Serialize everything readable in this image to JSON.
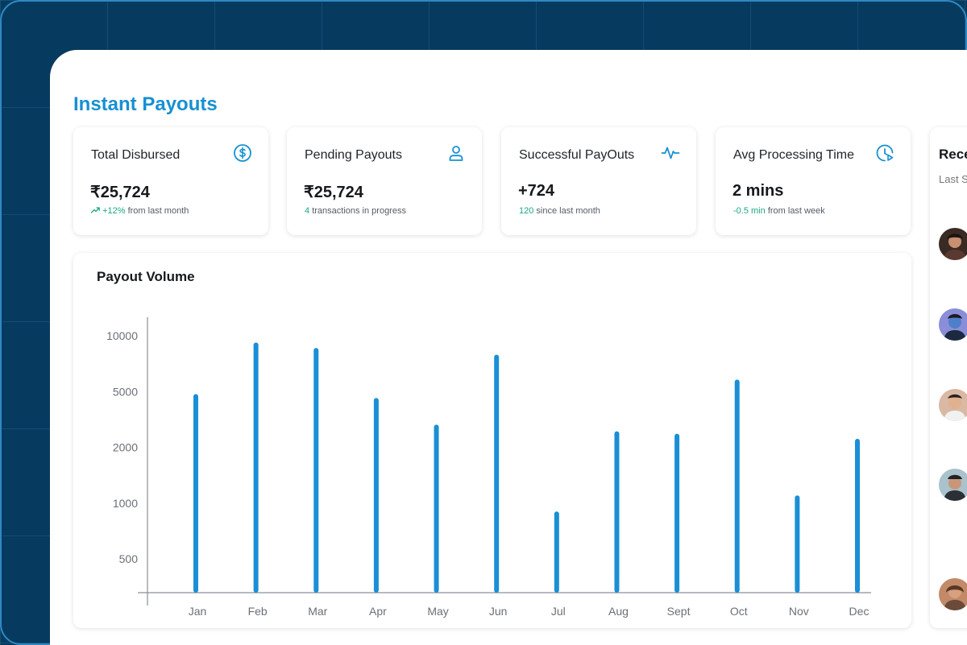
{
  "page": {
    "title": "Instant Payouts"
  },
  "cards": [
    {
      "title": "Total Disbursed",
      "icon": "dollar-circle-icon",
      "value": "₹25,724",
      "sub_accent": "+12%",
      "sub_text": "from last month",
      "trend_icon": "trend-up-icon"
    },
    {
      "title": "Pending Payouts",
      "icon": "user-icon",
      "value": "₹25,724",
      "sub_accent": "4",
      "sub_text": "transactions in progress"
    },
    {
      "title": "Successful PayOuts",
      "icon": "activity-icon",
      "value": "+724",
      "sub_accent": "120",
      "sub_text": "since last month"
    },
    {
      "title": "Avg Processing Time",
      "icon": "clock-play-icon",
      "value": "2 mins",
      "sub_accent": "-0.5 min",
      "sub_text": "from last week"
    }
  ],
  "side_panel": {
    "title": "Rece",
    "subtitle": "Last S"
  },
  "colors": {
    "accent": "#1790d2",
    "bar": "#1a8fd6",
    "positive": "#1aa884",
    "background": "#063b5f"
  },
  "chart_data": {
    "type": "bar",
    "title": "Payout Volume",
    "categories": [
      "Jan",
      "Feb",
      "Mar",
      "Apr",
      "May",
      "Jun",
      "Jul",
      "Aug",
      "Sept",
      "Oct",
      "Nov",
      "Dec"
    ],
    "values": [
      4800,
      9200,
      8600,
      4500,
      2900,
      7900,
      900,
      2600,
      2500,
      5800,
      1100,
      2300
    ],
    "y_ticks": [
      500,
      1000,
      2000,
      5000,
      10000
    ],
    "ylim": [
      250,
      10000
    ],
    "yscale": "log",
    "grid": false
  }
}
